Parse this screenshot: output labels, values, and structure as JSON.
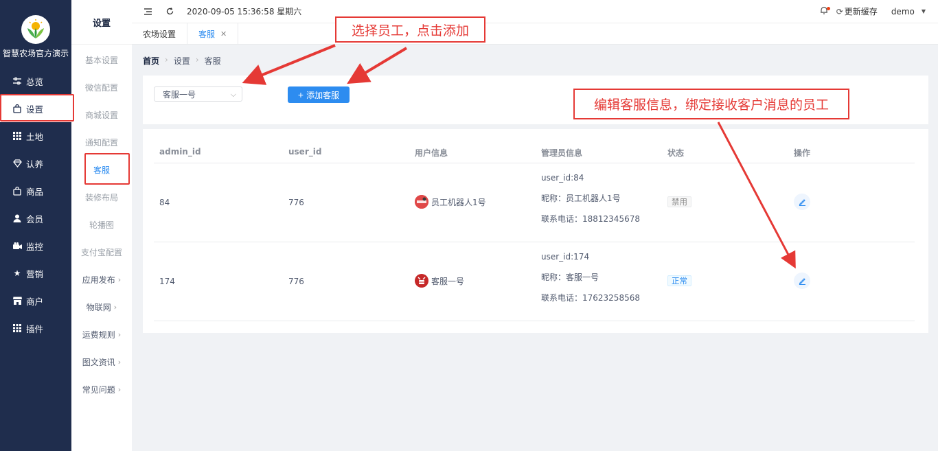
{
  "brand": {
    "name": "智慧农场官方演示"
  },
  "sidebar": {
    "items": [
      {
        "label": "总览",
        "icon": "sliders-icon"
      },
      {
        "label": "设置",
        "icon": "bag-icon",
        "active": true
      },
      {
        "label": "土地",
        "icon": "grid-icon"
      },
      {
        "label": "认养",
        "icon": "gem-icon"
      },
      {
        "label": "商品",
        "icon": "bag-icon"
      },
      {
        "label": "会员",
        "icon": "user-icon"
      },
      {
        "label": "监控",
        "icon": "camera-icon"
      },
      {
        "label": "营销",
        "icon": "star-icon"
      },
      {
        "label": "商户",
        "icon": "store-icon"
      },
      {
        "label": "插件",
        "icon": "grid-icon"
      }
    ]
  },
  "submenu": {
    "title": "设置",
    "items": [
      {
        "label": "基本设置"
      },
      {
        "label": "微信配置"
      },
      {
        "label": "商城设置"
      },
      {
        "label": "通知配置"
      },
      {
        "label": "客服",
        "active": true
      },
      {
        "label": "装修布局"
      },
      {
        "label": "轮播图"
      },
      {
        "label": "支付宝配置"
      },
      {
        "label": "应用发布",
        "chevron": true
      },
      {
        "label": "物联网",
        "chevron": true
      },
      {
        "label": "运费规则",
        "chevron": true
      },
      {
        "label": "图文资讯",
        "chevron": true
      },
      {
        "label": "常见问题",
        "chevron": true
      }
    ]
  },
  "header": {
    "datetime": "2020-09-05 15:36:58 星期六",
    "refresh_cache": "更新缓存",
    "username": "demo"
  },
  "tabs": [
    {
      "label": "农场设置"
    },
    {
      "label": "客服",
      "active": true
    }
  ],
  "breadcrumb": [
    "首页",
    "设置",
    "客服"
  ],
  "toolbar": {
    "select_value": "客服一号",
    "add_label": "添加客服"
  },
  "table": {
    "columns": [
      "admin_id",
      "user_id",
      "用户信息",
      "管理员信息",
      "状态",
      "操作"
    ],
    "rows": [
      {
        "admin_id": "84",
        "user_id": "776",
        "user_name": "员工机器人1号",
        "mgr_userid": "user_id:84",
        "mgr_nick": "昵称：员工机器人1号",
        "mgr_phone": "联系电话：18812345678",
        "status": "禁用"
      },
      {
        "admin_id": "174",
        "user_id": "776",
        "user_name": "客服一号",
        "mgr_userid": "user_id:174",
        "mgr_nick": "昵称：客服一号",
        "mgr_phone": "联系电话：17623258568",
        "status": "正常"
      }
    ]
  },
  "annotations": {
    "select_add": "选择员工，点击添加",
    "edit_bind": "编辑客服信息，绑定接收客户消息的员工"
  },
  "colors": {
    "sidebar_bg": "#1f2d4d",
    "primary": "#2d8cf0",
    "annotation": "#e53935"
  }
}
